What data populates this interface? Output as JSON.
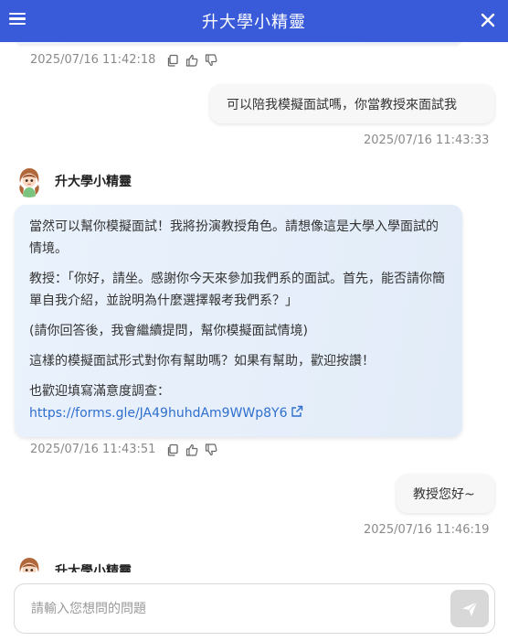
{
  "header": {
    "title": "升大學小精靈"
  },
  "messages": {
    "prev_bot_meta": {
      "timestamp": "2025/07/16 11:42:18"
    },
    "user_1": {
      "text": "可以陪我模擬面試嗎，你當教授來面試我",
      "timestamp": "2025/07/16 11:43:33"
    },
    "bot_1": {
      "name": "升大學小精靈",
      "paragraphs": [
        "當然可以幫你模擬面試！我將扮演教授角色。請想像這是大學入學面試的情境。",
        "教授：「你好，請坐。感謝你今天來參加我們系的面試。首先，能否請你簡單自我介紹，並說明為什麼選擇報考我們系？」",
        "(請你回答後，我會繼續提問，幫你模擬面試情境)",
        "這樣的模擬面試形式對你有幫助嗎？如果有幫助，歡迎按讚！",
        "也歡迎填寫滿意度調查："
      ],
      "link": "https://forms.gle/JA49huhdAm9WWp8Y6",
      "timestamp": "2025/07/16 11:43:51"
    },
    "user_2": {
      "text": "教授您好~",
      "timestamp": "2025/07/16 11:46:19"
    },
    "bot_2": {
      "name": "升大學小精靈"
    }
  },
  "input": {
    "placeholder": "請輸入您想問的問題",
    "value": ""
  },
  "icons": {
    "menu": "menu-icon",
    "close": "close-icon",
    "copy": "copy-icon",
    "like": "thumbs-up-icon",
    "dislike": "thumbs-down-icon",
    "external": "external-link-icon",
    "send": "send-icon"
  },
  "colors": {
    "header": "#3a5bd9",
    "link": "#2f6fce",
    "send_button": "#d8d8d8"
  }
}
